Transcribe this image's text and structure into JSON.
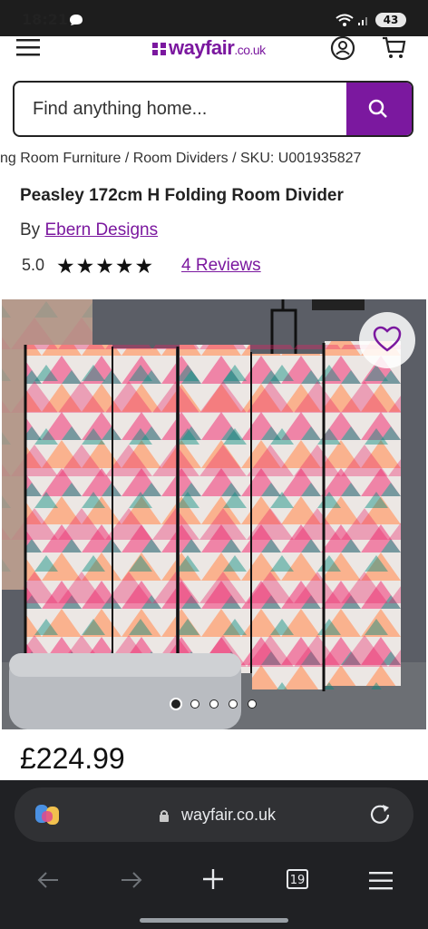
{
  "status_bar": {
    "time": "18:21",
    "battery": "43"
  },
  "header": {
    "logo_main": "wayfair",
    "logo_suffix": ".co.uk"
  },
  "search": {
    "placeholder": "Find anything home..."
  },
  "breadcrumb": {
    "text": "ng Room Furniture  /  Room Dividers  /  SKU: U001935827"
  },
  "product": {
    "title": "Peasley 172cm H Folding Room Divider",
    "by_prefix": "By",
    "brand": "Ebern Designs",
    "rating": "5.0",
    "reviews": "4 Reviews",
    "price": "£224.99",
    "image_count": 5,
    "active_image": 1
  },
  "browser": {
    "url": "wayfair.co.uk",
    "tab_count": "19"
  },
  "colors": {
    "accent": "#7b189f",
    "dark_bar": "#202124"
  },
  "icons": [
    "menu-icon",
    "account-icon",
    "cart-icon",
    "search-icon",
    "heart-icon",
    "copilot-icon",
    "lock-icon",
    "reload-icon",
    "back-icon",
    "forward-icon",
    "new-tab-icon",
    "tabs-icon",
    "browser-menu-icon"
  ]
}
